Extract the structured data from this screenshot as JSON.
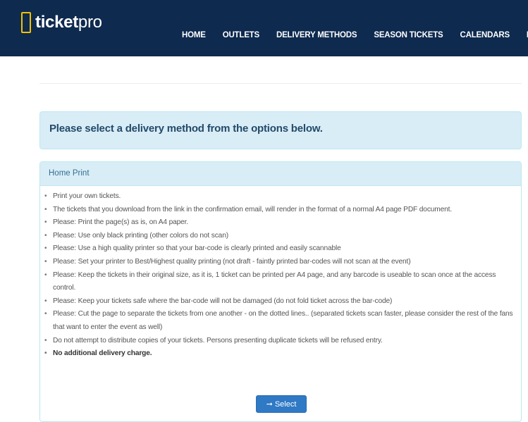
{
  "brand": {
    "bold": "ticket",
    "light": "pro"
  },
  "nav": [
    "HOME",
    "OUTLETS",
    "DELIVERY METHODS",
    "SEASON TICKETS",
    "CALENDARS",
    "F"
  ],
  "alert": {
    "text": "Please select a delivery method from the options below."
  },
  "panel": {
    "title": "Home Print",
    "items": [
      "Print your own tickets.",
      "The tickets that you download from the link in the confirmation email, will render in the format of a normal A4 page PDF document.",
      "Please: Print the page(s) as is, on A4 paper.",
      "Please: Use only black printing (other colors do not scan)",
      "Please: Use a high quality printer so that your bar-code is clearly printed and easily scannable",
      "Please: Set your printer to Best/Highest quality printing (not draft - faintly printed bar-codes will not scan at the event)",
      "Please: Keep the tickets in their original size, as it is, 1 ticket can be printed per A4 page, and any barcode is useable to scan once at the access control.",
      "Please: Keep your tickets safe where the bar-code will not be damaged (do not fold ticket across the bar-code)",
      "Please: Cut the page to separate the tickets from one another - on the dotted lines.. (separated tickets scan faster, please consider the rest of the fans that want to enter the event as well)",
      "Do not attempt to distribute copies of your tickets. Persons presenting duplicate tickets will be refused entry.",
      "No additional delivery charge."
    ],
    "select_label": "Select",
    "select_icon": "arrow-right-icon"
  },
  "colors": {
    "navbar": "#0e2a4f",
    "logo_accent": "#f2c200",
    "alert_bg": "#d9edf7",
    "button": "#2f79c5"
  }
}
